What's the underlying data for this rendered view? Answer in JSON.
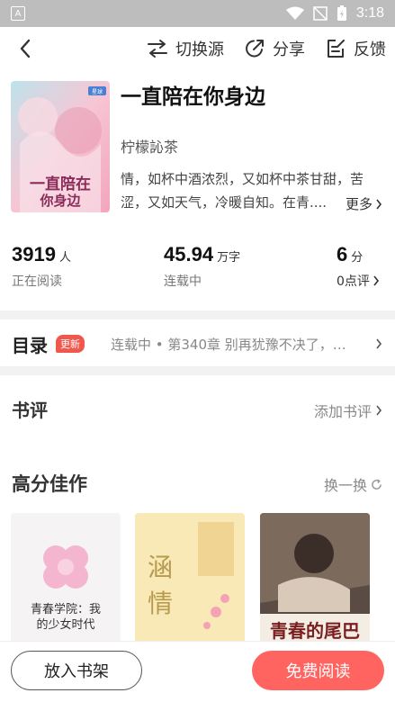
{
  "status_bar": {
    "time": "3:18"
  },
  "topbar": {
    "switch_source_label": "切换源",
    "share_label": "分享",
    "feedback_label": "反馈"
  },
  "book": {
    "title": "一直陪在你身边",
    "author": "柠檬訫茶",
    "description": "情，如杯中酒浓烈，又如杯中茶甘甜，苦涩，又如天气，冷暖自知。在青....",
    "more_label": "更多",
    "cover_text": "一直陪在你身边",
    "cover_badge": "星球"
  },
  "stats": {
    "readers": {
      "value": "3919",
      "unit": "人",
      "label": "正在阅读"
    },
    "words": {
      "value": "45.94",
      "unit": "万字",
      "label": "连载中"
    },
    "score": {
      "value": "6",
      "unit": "分",
      "label": "0点评"
    }
  },
  "catalog": {
    "title": "目录",
    "badge": "更新",
    "latest": "连载中 • 第340章 别再犹豫不决了，…"
  },
  "reviews": {
    "title": "书评",
    "add_label": "添加书评"
  },
  "recommend": {
    "title": "高分佳作",
    "refresh_label": "换一换",
    "books": [
      {
        "cover_text": "青春学院：我的少女时代"
      },
      {
        "cover_text": "涵情"
      },
      {
        "cover_text": "青春的尾巴"
      }
    ]
  },
  "bottom_bar": {
    "shelf_label": "放入书架",
    "read_label": "免费阅读"
  },
  "colors": {
    "accent": "#ff6461",
    "badge": "#f0584d",
    "divider": "#f2f2f2"
  }
}
